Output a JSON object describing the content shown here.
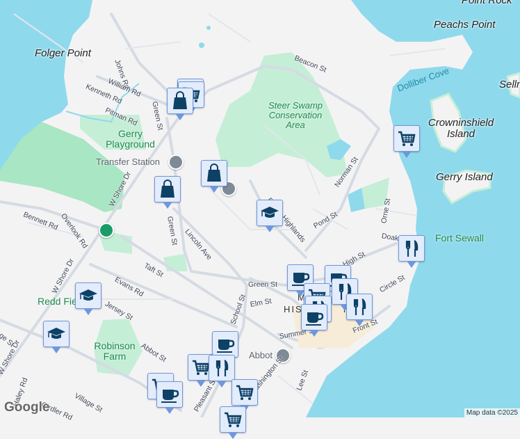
{
  "places": {
    "folger_point": "Folger Point",
    "peachs_point": "Peachs Point",
    "point_rock": "Point Rock",
    "crowninshield": "Crowninshield Island",
    "gerry_island": "Gerry Island",
    "sellman": "Sellm"
  },
  "parks": {
    "steer_swamp": "Steer Swamp Conservation Area",
    "gerry_playground": "Gerry Playground",
    "fort_sewall": "Fort Sewall",
    "redd_field": "Redd Fie",
    "robinson_farm": "Robinson Farm"
  },
  "water": {
    "dolliber_cove": "Dolliber Cove"
  },
  "pois": {
    "transfer_station": "Transfer Station",
    "abbot_hall": "Abbot Hall"
  },
  "district": {
    "line1": "M",
    "line2": "HIS          T"
  },
  "streets": {
    "johns": "Johns Rd",
    "william": "William Rd",
    "kenneth": "Kenneth Rd",
    "pitman": "Pitman Rd",
    "green_n": "Green St",
    "beacon": "Beacon St",
    "w_shore_1": "W Shore Dr",
    "w_shore_2": "W Shore Dr",
    "w_shore_3": "W Shore Dr",
    "bennett": "Bennett Rd",
    "overlook": "Overlook Rd",
    "green_s": "Green St",
    "lincoln": "Lincoln Ave",
    "taft": "Taft St",
    "evans": "Evans Rd",
    "jersey": "Jersey St",
    "abbot": "Abbot St",
    "village": "Village St",
    "village2": "ge St",
    "haley": "Haley Rd",
    "girdler": "Girdler Rd",
    "norman": "Norman St",
    "peach_highlands": "Peach Highlands",
    "pond": "Pond St",
    "orne": "Orne St",
    "doaks": "Doaks Ln",
    "high": "High St",
    "green_e": "Green St",
    "elm": "Elm St",
    "circle": "Circle St",
    "front": "Front St",
    "summer": "Summer St",
    "lee": "Lee St",
    "pleasant": "Pleasant St",
    "school": "School St",
    "washington": "Washington St"
  },
  "markers": [
    "shopping-bag",
    "shopping-cart",
    "shopping-bag",
    "shopping-bag",
    "school",
    "school",
    "school",
    "shopping-cart",
    "restaurant",
    "coffee",
    "restaurant",
    "restaurant",
    "coffee",
    "coffee",
    "shopping-cart",
    "restaurant",
    "shopping-cart",
    "coffee",
    "shopping-cart"
  ],
  "branding": {
    "logo": "Google",
    "attribution": "Map data ©2025"
  },
  "colors": {
    "water": "#8fd9ec",
    "land": "#f4f3f4",
    "park": "#c5eed7",
    "road": "#d5dbe3",
    "marker_fill": "#e3ecfb",
    "marker_icon": "#0d4166"
  }
}
